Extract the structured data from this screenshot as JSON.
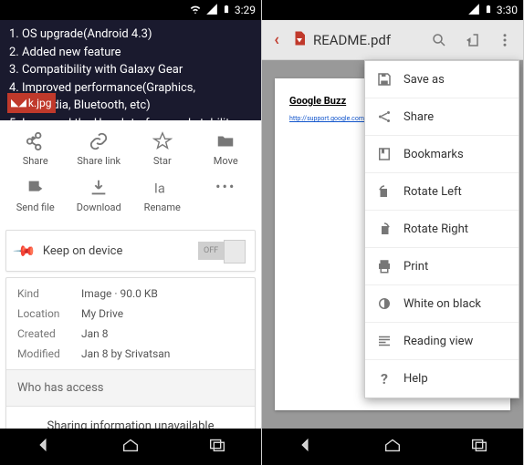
{
  "left": {
    "statusbar": {
      "time": "3:29"
    },
    "bg_list": [
      "OS upgrade(Android 4.3)",
      "Added new feature",
      "Compatibility with Galaxy Gear",
      "Improved performance(Graphics, Multimedia, Bluetooth, etc)",
      "Improved the User Interface and stability"
    ],
    "thumb_label": "k.jpg",
    "actions": {
      "share": "Share",
      "sharelink": "Share link",
      "star": "Star",
      "move": "Move",
      "sendfile": "Send file",
      "download": "Download",
      "rename": "Rename"
    },
    "keep_label": "Keep on device",
    "toggle_value": "OFF",
    "meta": {
      "kind_k": "Kind",
      "kind_v": "Image · 90.0 KB",
      "loc_k": "Location",
      "loc_v": "My Drive",
      "created_k": "Created",
      "created_v": "Jan 8",
      "modified_k": "Modified",
      "modified_v": "Jan 8 by Srivatsan"
    },
    "access_title": "Who has access",
    "share_info": "Sharing information unavailable"
  },
  "right": {
    "statusbar": {
      "time": "3:30"
    },
    "title": "README.pdf",
    "doc": {
      "heading": "Google Buzz",
      "link": "http://support.google.com/drive/?s=dl"
    },
    "menu": {
      "saveas": "Save as",
      "share": "Share",
      "bookmarks": "Bookmarks",
      "rotleft": "Rotate Left",
      "rotright": "Rotate Right",
      "print": "Print",
      "whiteblack": "White on black",
      "reading": "Reading view",
      "help": "Help"
    }
  }
}
